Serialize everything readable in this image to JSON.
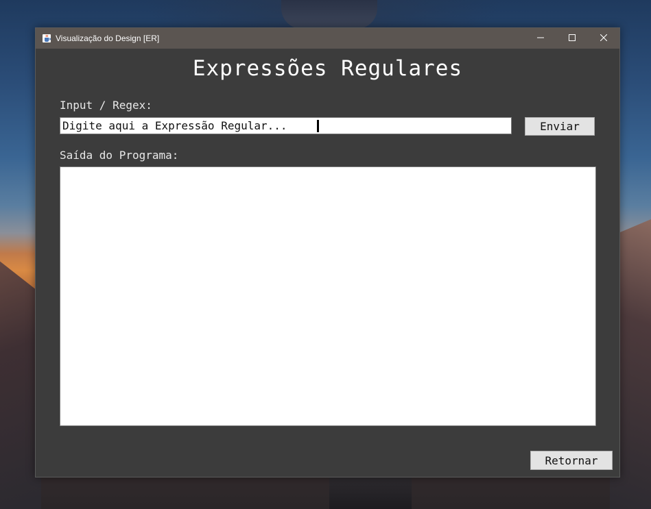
{
  "window": {
    "title": "Visualização do Design [ER]",
    "icons": {
      "app": "java-cup-icon",
      "minimize": "minimize-icon",
      "maximize": "maximize-icon",
      "close": "close-icon"
    }
  },
  "main": {
    "title": "Expressões Regulares",
    "input_label": "Input / Regex:",
    "input_value": "Digite aqui a Expressão Regular...",
    "send_button": "Enviar",
    "output_label": "Saída do Programa:",
    "output_value": "",
    "back_button": "Retornar"
  },
  "colors": {
    "window_background": "#3c3c3c",
    "titlebar": "#5b5551",
    "button": "#e3e3e3"
  }
}
